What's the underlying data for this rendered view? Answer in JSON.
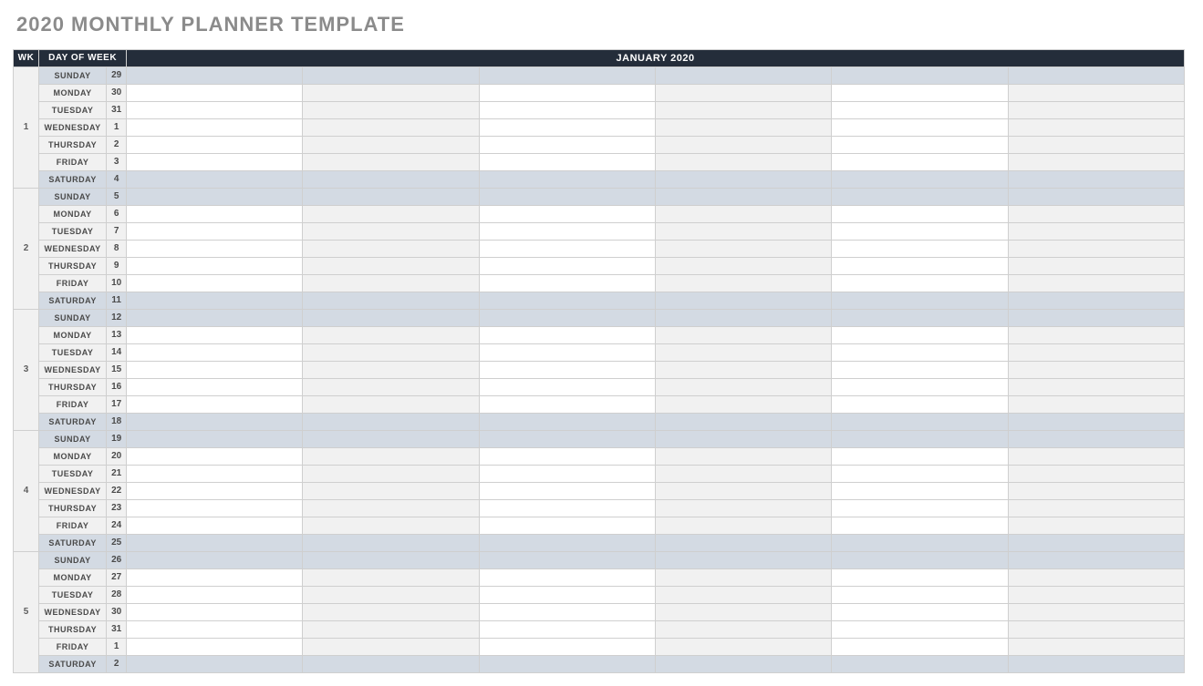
{
  "title": "2020 MONTHLY PLANNER TEMPLATE",
  "header": {
    "wk": "WK",
    "dow": "DAY OF WEEK",
    "month": "JANUARY 2020"
  },
  "slot_count": 6,
  "weeks": [
    {
      "wk": "1",
      "days": [
        {
          "dow": "SUNDAY",
          "date": "29",
          "weekend": true
        },
        {
          "dow": "MONDAY",
          "date": "30",
          "weekend": false
        },
        {
          "dow": "TUESDAY",
          "date": "31",
          "weekend": false
        },
        {
          "dow": "WEDNESDAY",
          "date": "1",
          "weekend": false
        },
        {
          "dow": "THURSDAY",
          "date": "2",
          "weekend": false
        },
        {
          "dow": "FRIDAY",
          "date": "3",
          "weekend": false
        },
        {
          "dow": "SATURDAY",
          "date": "4",
          "weekend": true
        }
      ]
    },
    {
      "wk": "2",
      "days": [
        {
          "dow": "SUNDAY",
          "date": "5",
          "weekend": true
        },
        {
          "dow": "MONDAY",
          "date": "6",
          "weekend": false
        },
        {
          "dow": "TUESDAY",
          "date": "7",
          "weekend": false
        },
        {
          "dow": "WEDNESDAY",
          "date": "8",
          "weekend": false
        },
        {
          "dow": "THURSDAY",
          "date": "9",
          "weekend": false
        },
        {
          "dow": "FRIDAY",
          "date": "10",
          "weekend": false
        },
        {
          "dow": "SATURDAY",
          "date": "11",
          "weekend": true
        }
      ]
    },
    {
      "wk": "3",
      "days": [
        {
          "dow": "SUNDAY",
          "date": "12",
          "weekend": true
        },
        {
          "dow": "MONDAY",
          "date": "13",
          "weekend": false
        },
        {
          "dow": "TUESDAY",
          "date": "14",
          "weekend": false
        },
        {
          "dow": "WEDNESDAY",
          "date": "15",
          "weekend": false
        },
        {
          "dow": "THURSDAY",
          "date": "16",
          "weekend": false
        },
        {
          "dow": "FRIDAY",
          "date": "17",
          "weekend": false
        },
        {
          "dow": "SATURDAY",
          "date": "18",
          "weekend": true
        }
      ]
    },
    {
      "wk": "4",
      "days": [
        {
          "dow": "SUNDAY",
          "date": "19",
          "weekend": true
        },
        {
          "dow": "MONDAY",
          "date": "20",
          "weekend": false
        },
        {
          "dow": "TUESDAY",
          "date": "21",
          "weekend": false
        },
        {
          "dow": "WEDNESDAY",
          "date": "22",
          "weekend": false
        },
        {
          "dow": "THURSDAY",
          "date": "23",
          "weekend": false
        },
        {
          "dow": "FRIDAY",
          "date": "24",
          "weekend": false
        },
        {
          "dow": "SATURDAY",
          "date": "25",
          "weekend": true
        }
      ]
    },
    {
      "wk": "5",
      "days": [
        {
          "dow": "SUNDAY",
          "date": "26",
          "weekend": true
        },
        {
          "dow": "MONDAY",
          "date": "27",
          "weekend": false
        },
        {
          "dow": "TUESDAY",
          "date": "28",
          "weekend": false
        },
        {
          "dow": "WEDNESDAY",
          "date": "30",
          "weekend": false
        },
        {
          "dow": "THURSDAY",
          "date": "31",
          "weekend": false
        },
        {
          "dow": "FRIDAY",
          "date": "1",
          "weekend": false
        },
        {
          "dow": "SATURDAY",
          "date": "2",
          "weekend": true
        }
      ]
    }
  ]
}
